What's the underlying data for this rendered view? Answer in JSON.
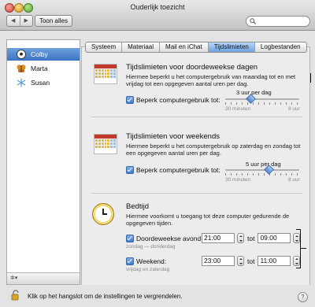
{
  "window": {
    "title": "Ouderlijk toezicht"
  },
  "toolbar": {
    "back": "◀",
    "forward": "▶",
    "show_all": "Toon alles",
    "search_placeholder": ""
  },
  "users": [
    {
      "name": "Colby",
      "icon": "soccer-ball-icon",
      "selected": true
    },
    {
      "name": "Marta",
      "icon": "butterfly-icon",
      "selected": false
    },
    {
      "name": "Susan",
      "icon": "snowflake-icon",
      "selected": false
    }
  ],
  "sidebar_footer": {
    "gear": "✲▾"
  },
  "tabs": [
    {
      "label": "Systeem"
    },
    {
      "label": "Materiaal"
    },
    {
      "label": "Mail en iChat"
    },
    {
      "label": "Tijdslimieten",
      "active": true
    },
    {
      "label": "Logbestanden"
    }
  ],
  "weekday": {
    "title": "Tijdslimieten voor doordeweekse dagen",
    "description_1": "Hiermee beperkt u het computergebruik van maandag tot en met",
    "description_2": "vrijdag tot een opgegeven aantal uren per dag.",
    "checkbox_label": "Beperk computergebruik tot:",
    "slider_value": "3 uur per dag",
    "slider_min": "30 minuten",
    "slider_max": "8 uur",
    "slider_fraction": 0.33
  },
  "weekend": {
    "title": "Tijdslimieten voor weekends",
    "description_1": "Hiermee beperkt u het computergebruik op zaterdag en zondag tot",
    "description_2": "een opgegeven aantal uren per dag.",
    "checkbox_label": "Beperk computergebruik tot:",
    "slider_value": "5 uur per dag",
    "slider_min": "30 minuten",
    "slider_max": "8 uur",
    "slider_fraction": 0.6
  },
  "bedtime": {
    "title": "Bedtijd",
    "description_1": "Hiermee voorkomt u toegang tot deze computer gedurende de",
    "description_2": "opgegeven tijden.",
    "weekdays_label": "Doordeweekse avond:",
    "weekdays_sub": "zondag — donderdag",
    "weekdays_from": "21:00",
    "weekdays_to": "09:00",
    "weekend_label": "Weekend:",
    "weekend_sub": "vrijdag en zaterdag",
    "weekend_from": "23:00",
    "weekend_to": "11:00",
    "tot": "tot"
  },
  "footer": {
    "lock_text": "Klik op het hangslot om de instellingen te vergrendelen.",
    "help": "?"
  },
  "colors": {
    "accent": "#3b74c6",
    "calendar_red": "#c0392b"
  }
}
